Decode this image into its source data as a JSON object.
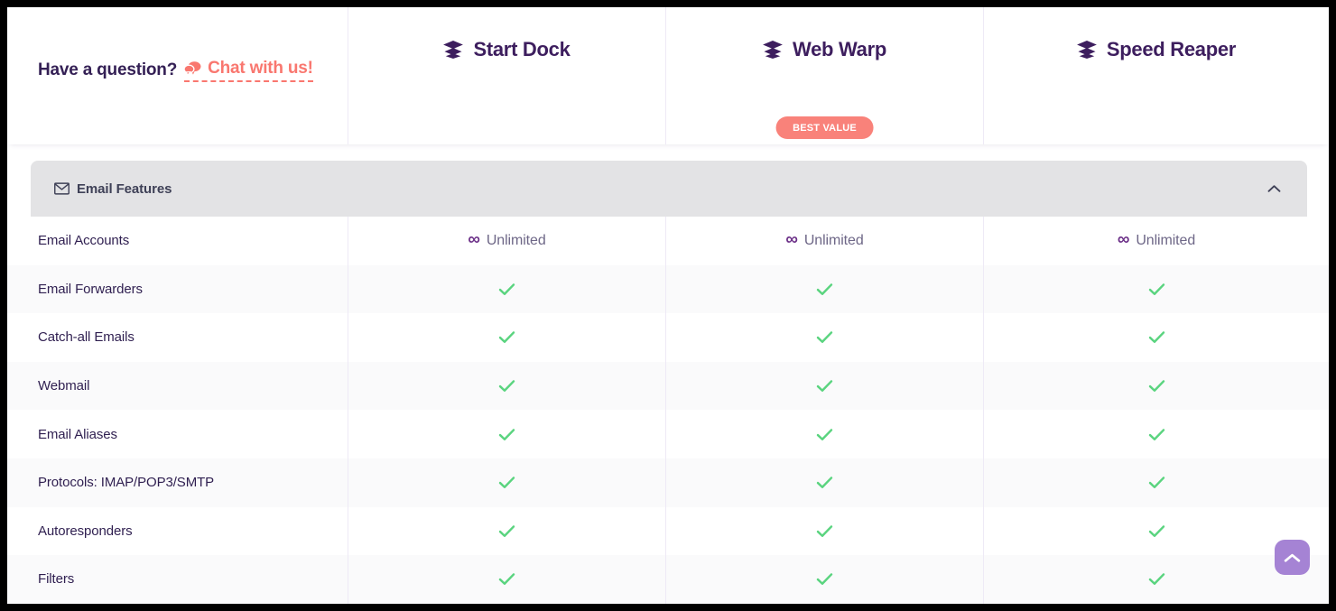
{
  "header": {
    "question_text": "Have a question?",
    "chat_link_label": "Chat with us!",
    "chat_icon": "chat-bubbles-icon",
    "plans": [
      {
        "name": "Start Dock",
        "icon": "layers-icon",
        "badge": null
      },
      {
        "name": "Web Warp",
        "icon": "layers-icon",
        "badge": "BEST VALUE"
      },
      {
        "name": "Speed Reaper",
        "icon": "layers-icon",
        "badge": null
      }
    ]
  },
  "section": {
    "title": "Email Features",
    "icon": "envelope-icon",
    "collapse_icon": "chevron-up-icon",
    "expanded": true
  },
  "table": {
    "rows": [
      {
        "label": "Email Accounts",
        "values": [
          "Unlimited",
          "Unlimited",
          "Unlimited"
        ],
        "type": "text"
      },
      {
        "label": "Email Forwarders",
        "values": [
          "check",
          "check",
          "check"
        ],
        "type": "check"
      },
      {
        "label": "Catch-all Emails",
        "values": [
          "check",
          "check",
          "check"
        ],
        "type": "check"
      },
      {
        "label": "Webmail",
        "values": [
          "check",
          "check",
          "check"
        ],
        "type": "check"
      },
      {
        "label": "Email Aliases",
        "values": [
          "check",
          "check",
          "check"
        ],
        "type": "check"
      },
      {
        "label": "Protocols: IMAP/POP3/SMTP",
        "values": [
          "check",
          "check",
          "check"
        ],
        "type": "check"
      },
      {
        "label": "Autoresponders",
        "values": [
          "check",
          "check",
          "check"
        ],
        "type": "check"
      },
      {
        "label": "Filters",
        "values": [
          "check",
          "check",
          "check"
        ],
        "type": "check"
      }
    ],
    "unlimited_symbol": "∞"
  },
  "scroll_top": {
    "icon": "chevron-up-icon",
    "label": "Scroll to top"
  },
  "colors": {
    "accent_coral": "#f9776f",
    "plan_purple": "#3d1e5e",
    "check_green": "#5ad47f",
    "badge_coral": "#f9827a",
    "section_gray": "#e3e3e5",
    "scroll_purple": "#a583d4",
    "row_alt": "#fafafb"
  }
}
